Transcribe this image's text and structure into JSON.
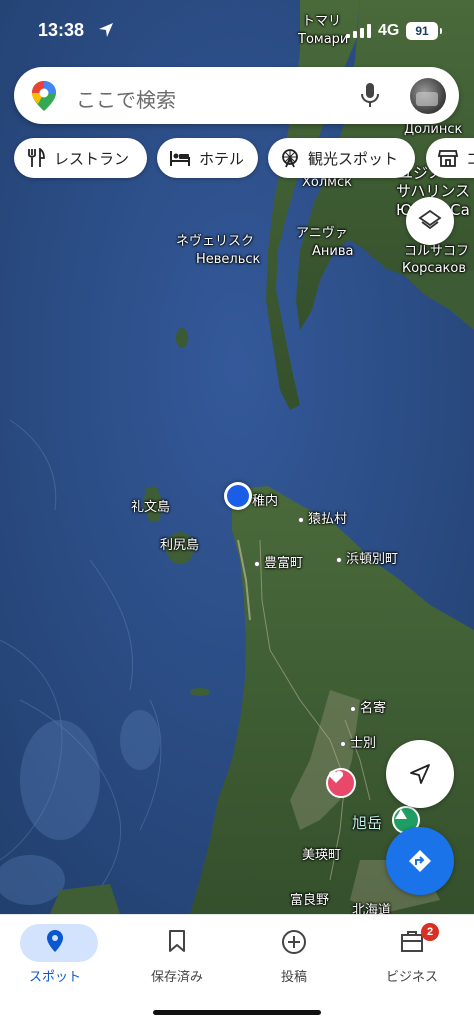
{
  "status_bar": {
    "time": "13:38",
    "network": "4G",
    "battery": "91"
  },
  "search": {
    "placeholder": "ここで検索"
  },
  "chips": [
    {
      "label": "レストラン",
      "icon": "fork-knife-icon"
    },
    {
      "label": "ホテル",
      "icon": "bed-icon"
    },
    {
      "label": "観光スポット",
      "icon": "ferris-wheel-icon"
    },
    {
      "label": "コ",
      "icon": "shop-icon"
    }
  ],
  "map": {
    "labels": {
      "tomari_jp": "トマリ",
      "tomari_ru": "Томари",
      "dolinsk_ru": "Долинск",
      "kholmsk_ru": "Холмск",
      "sakhalinsk_jp": "サハリンス",
      "yuzhno_jp": "ユジノ",
      "yuzhno_ru": "Южно-Са",
      "nevelsk_jp": "ネヴェリスク",
      "nevelsk_ru": "Невельск",
      "aniva_jp": "アニヴァ",
      "aniva_ru": "Анива",
      "korsakov_jp": "コルサコフ",
      "korsakov_ru": "Корсаков",
      "rebun": "礼文島",
      "rishiri": "利尻島",
      "wakkanai": "稚内",
      "sarufutsu": "猿払村",
      "toyotomi": "豊富町",
      "hamatonbetsu": "浜頓別町",
      "nayoro": "名寄",
      "shibetsu": "士別",
      "asahidake": "旭岳",
      "biei": "美瑛町",
      "furano": "富良野",
      "hokkaido": "北海道"
    }
  },
  "bottom_nav": [
    {
      "label": "スポット",
      "icon": "location-pin-icon",
      "active": true
    },
    {
      "label": "保存済み",
      "icon": "bookmark-icon",
      "active": false
    },
    {
      "label": "投稿",
      "icon": "add-circle-icon",
      "active": false
    },
    {
      "label": "ビジネス",
      "icon": "business-icon",
      "active": false,
      "badge": "2"
    }
  ],
  "colors": {
    "sea": "#2c4f86",
    "land": "#3c5a34",
    "accent": "#1a73e8",
    "active_pill": "#d3e3fd",
    "badge": "#d93025"
  }
}
